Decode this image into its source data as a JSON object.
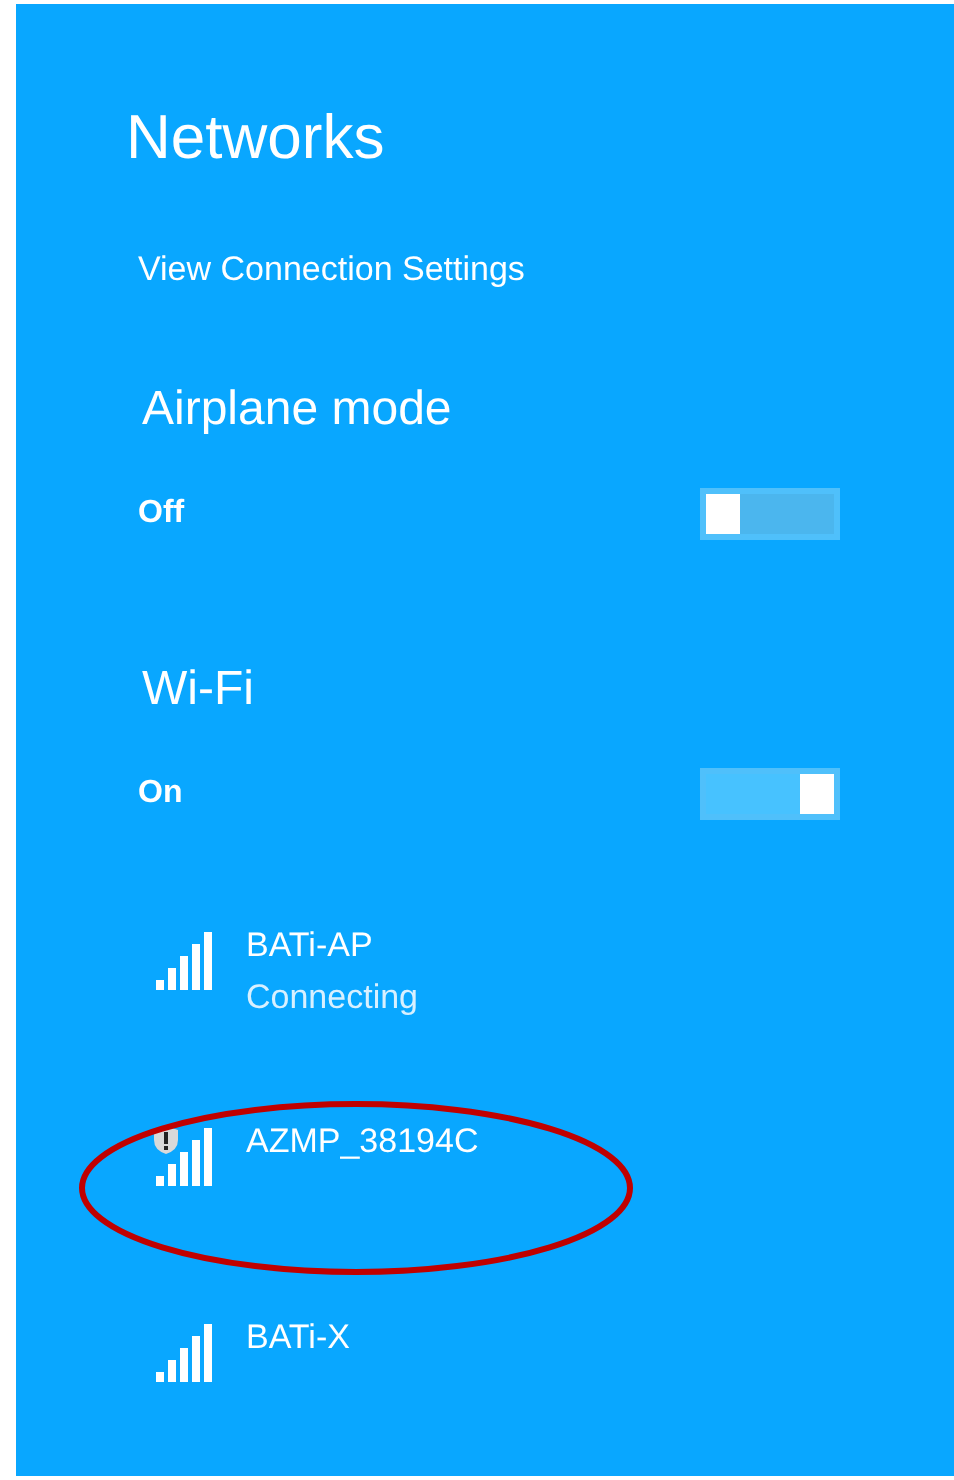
{
  "title": "Networks",
  "settings_link": "View Connection Settings",
  "sections": [
    {
      "heading": "Airplane mode",
      "state_label": "Off",
      "on": false
    },
    {
      "heading": "Wi-Fi",
      "state_label": "On",
      "on": true
    }
  ],
  "networks": [
    {
      "name": "BATi-AP",
      "status": "Connecting",
      "warning": false,
      "circled": false
    },
    {
      "name": "AZMP_38194C",
      "warning": true,
      "circled": true
    },
    {
      "name": "BATi-X",
      "warning": false,
      "circled": false
    }
  ]
}
